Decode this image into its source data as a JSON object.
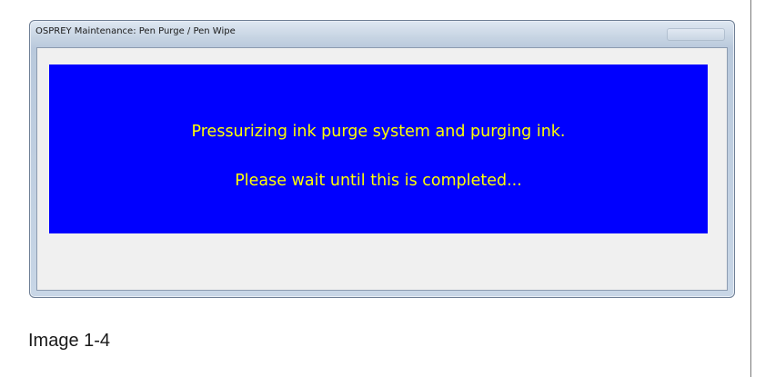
{
  "window": {
    "title": "OSPREY Maintenance:  Pen Purge / Pen Wipe"
  },
  "message": {
    "line1": "Pressurizing ink purge system and purging ink.",
    "line2": "Please wait until this is completed...",
    "background_color": "#0000ff",
    "text_color": "#ffff00"
  },
  "caption": "Image 1-4"
}
